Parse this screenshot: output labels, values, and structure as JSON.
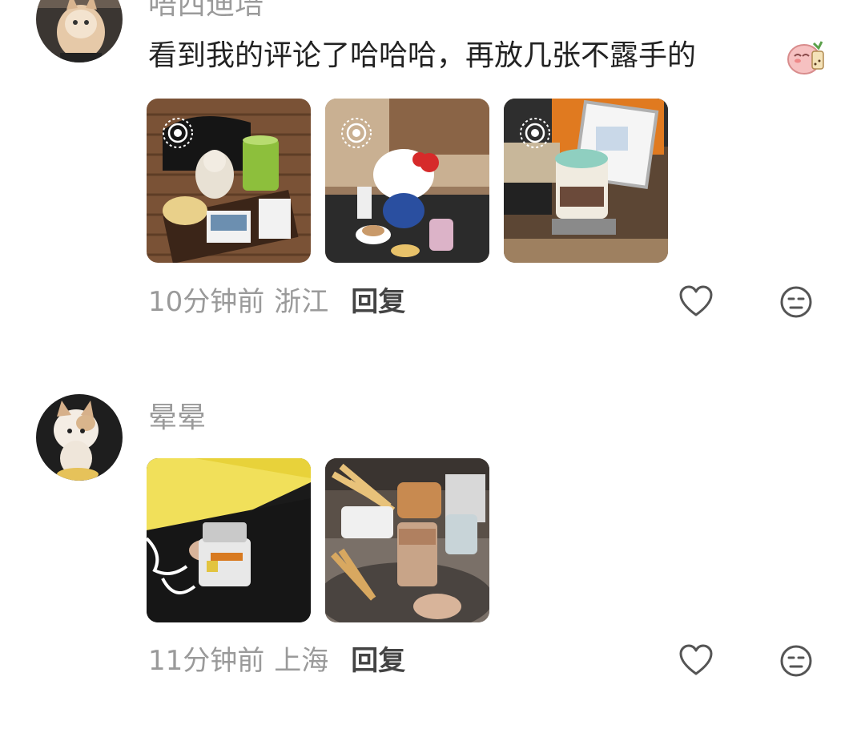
{
  "comments": [
    {
      "username": "唔西迪培",
      "text": "看到我的评论了哈哈哈，再放几张不露手的",
      "emoji": "peach-milk-tea-emoji",
      "time": "10分钟前",
      "location": "浙江",
      "reply_label": "回复"
    },
    {
      "username": "晕晕",
      "text": "",
      "time": "11分钟前",
      "location": "上海",
      "reply_label": "回复"
    }
  ],
  "icons": {
    "like": "heart-icon",
    "dislike": "meh-face-icon",
    "live_photo": "live-photo-icon"
  },
  "colors": {
    "secondary_text": "#9a9a9a",
    "primary_text": "#222222",
    "reply_text": "#444444"
  }
}
